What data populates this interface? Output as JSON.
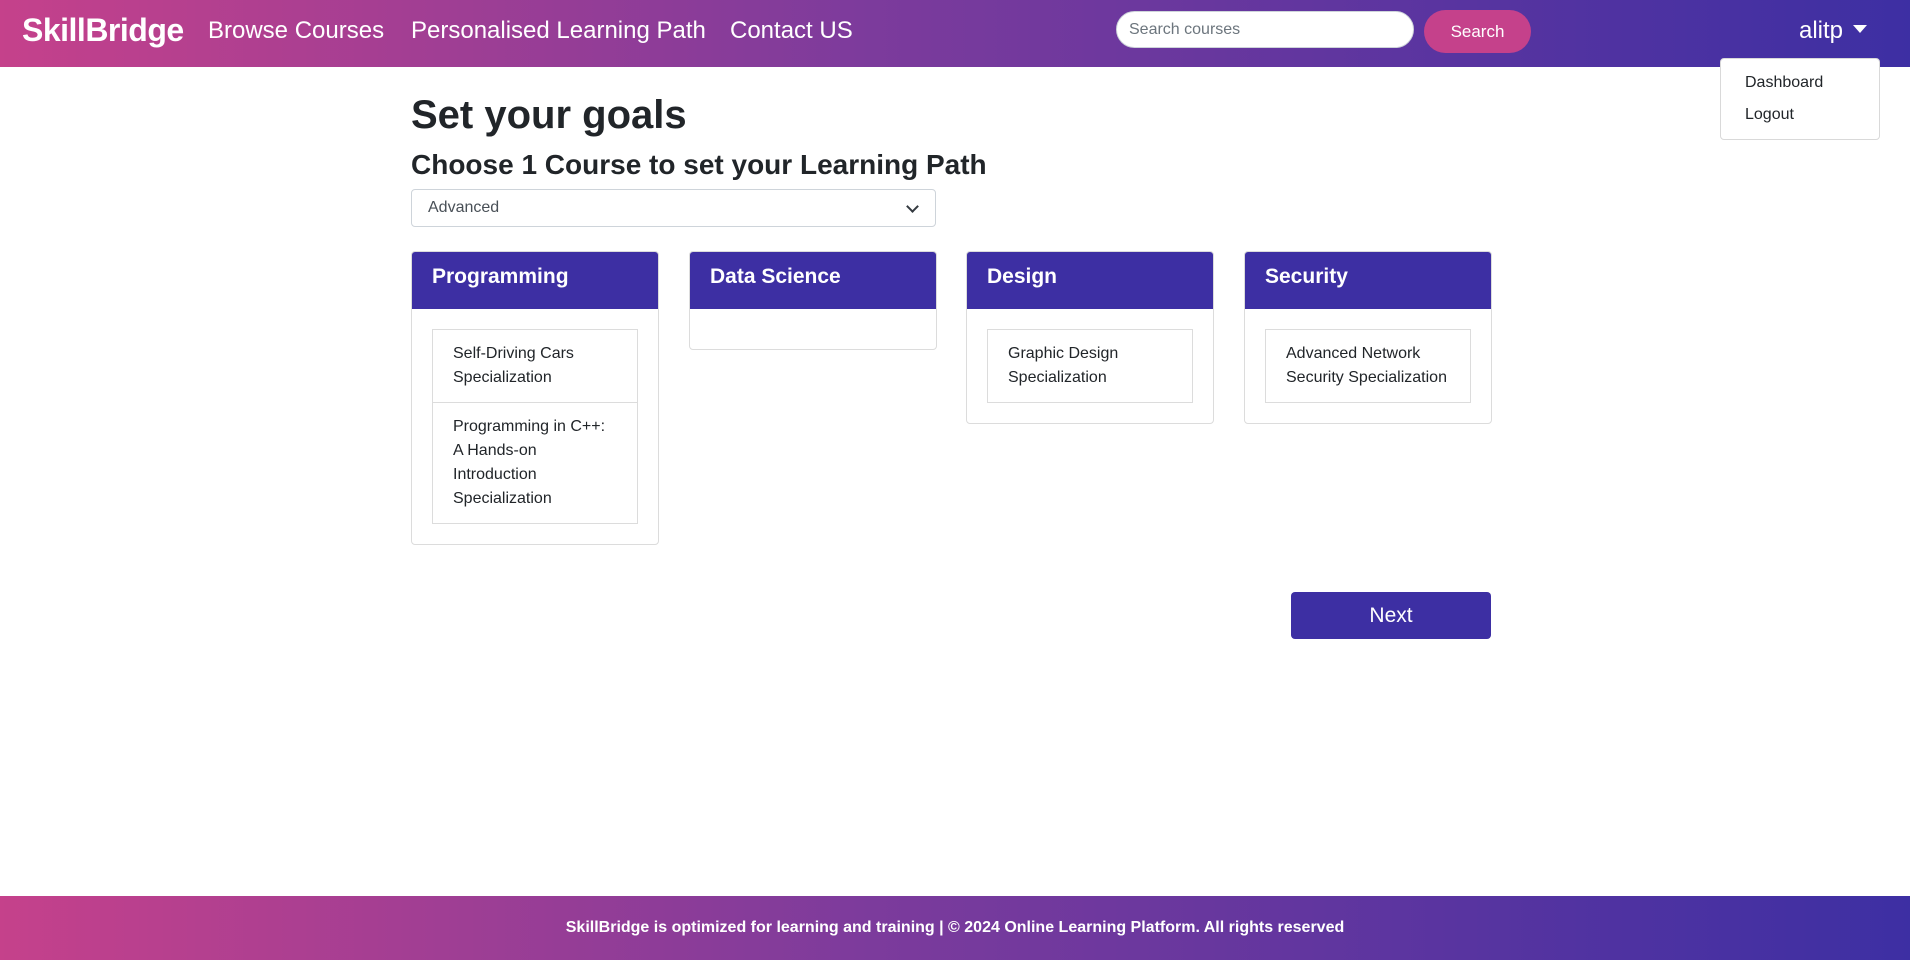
{
  "nav": {
    "brand": "SkillBridge",
    "links": [
      "Browse Courses",
      "Personalised Learning Path",
      "Contact US"
    ],
    "search_placeholder": "Search courses",
    "search_button": "Search",
    "user": "alitp",
    "dropdown": [
      "Dashboard",
      "Logout"
    ]
  },
  "main": {
    "title": "Set your goals",
    "subtitle": "Choose 1 Course to set your Learning Path",
    "level_selected": "Advanced",
    "categories": [
      {
        "name": "Programming",
        "courses": [
          "Self-Driving Cars Specialization",
          "Programming in C++: A Hands-on Introduction Specialization"
        ]
      },
      {
        "name": "Data Science",
        "courses": []
      },
      {
        "name": "Design",
        "courses": [
          "Graphic Design Specialization"
        ]
      },
      {
        "name": "Security",
        "courses": [
          "Advanced Network Security Specialization"
        ]
      }
    ],
    "next_button": "Next"
  },
  "footer": {
    "text": "SkillBridge is optimized for learning and training | © 2024 Online Learning Platform. All rights reserved"
  },
  "colors": {
    "primary": "#3d2fa3",
    "accent": "#c5418b"
  }
}
